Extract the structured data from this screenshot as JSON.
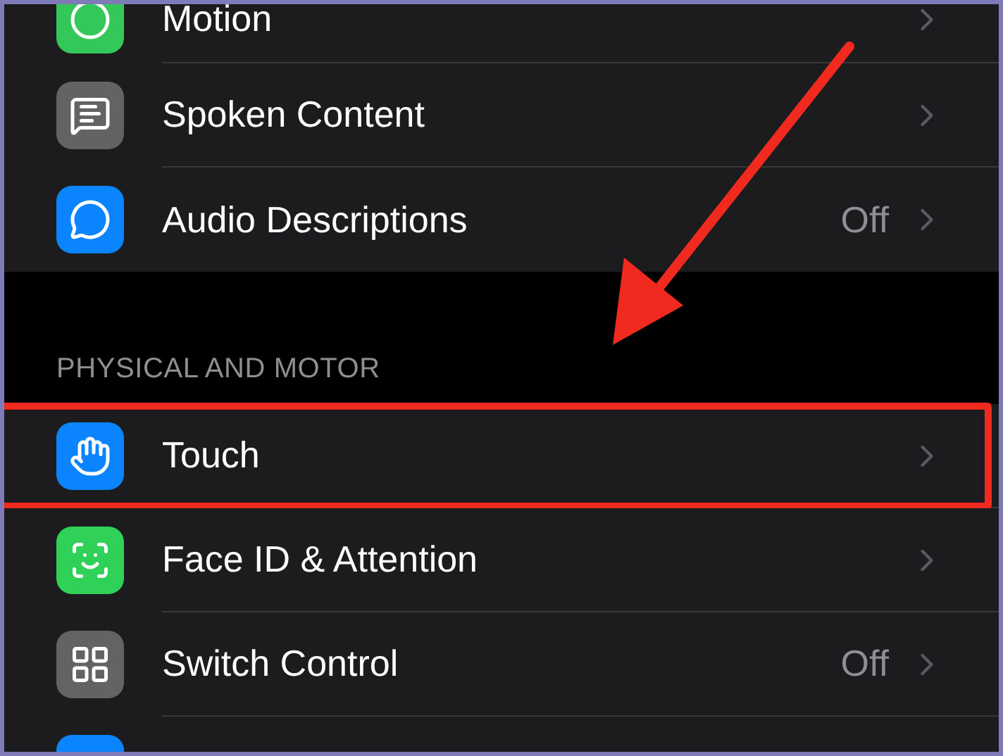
{
  "groups": [
    {
      "rows": [
        {
          "kind": "motion",
          "label": "Motion",
          "color": "#34c759",
          "highlighted": false
        },
        {
          "kind": "speech",
          "label": "Spoken Content",
          "color": "#636366",
          "highlighted": false
        },
        {
          "kind": "quote",
          "label": "Audio Descriptions",
          "value": "Off",
          "color": "#0a84ff",
          "highlighted": false
        }
      ]
    },
    {
      "header": "PHYSICAL AND MOTOR",
      "rows": [
        {
          "kind": "touch",
          "label": "Touch",
          "color": "#0a84ff",
          "highlighted": true
        },
        {
          "kind": "face",
          "label": "Face ID & Attention",
          "color": "#30d158",
          "highlighted": false
        },
        {
          "kind": "grid",
          "label": "Switch Control",
          "value": "Off",
          "color": "#636366",
          "highlighted": false
        },
        {
          "kind": "blank",
          "color": "#0a84ff",
          "highlighted": false
        }
      ]
    }
  ]
}
